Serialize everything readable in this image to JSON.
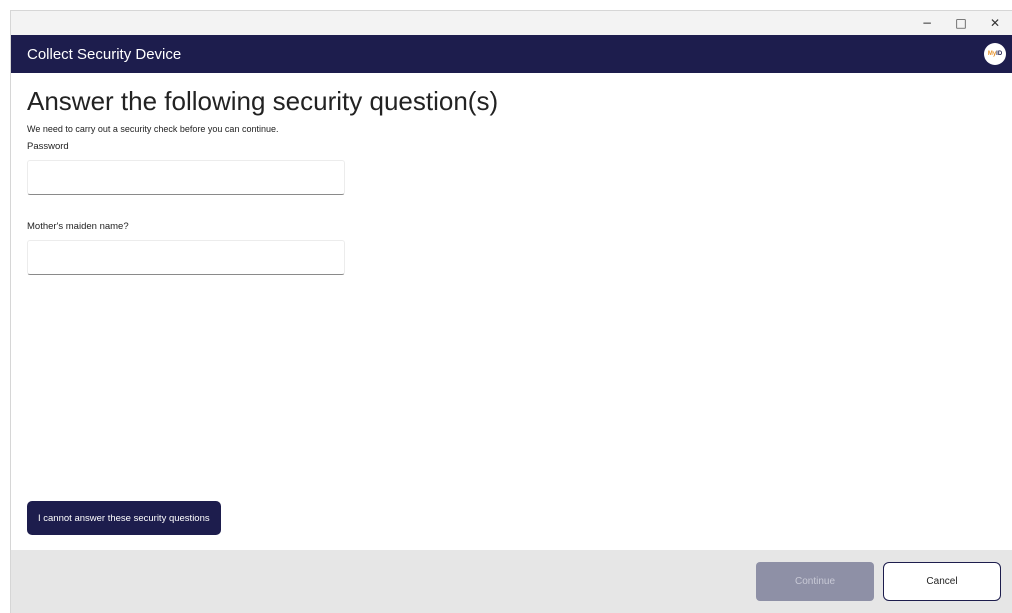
{
  "window": {
    "controls": {
      "minimize": "−",
      "maximize": "□",
      "close": "✕"
    }
  },
  "header": {
    "title": "Collect Security Device",
    "logo_my": "My",
    "logo_id": "ID"
  },
  "main": {
    "title": "Answer the following security question(s)",
    "subtitle": "We need to carry out a security check before you can continue.",
    "fields": [
      {
        "label": "Password",
        "value": "",
        "placeholder": ""
      },
      {
        "label": "Mother's maiden name?",
        "value": "",
        "placeholder": ""
      }
    ],
    "cannot_answer_label": "I cannot answer these security questions"
  },
  "footer": {
    "continue_label": "Continue",
    "cancel_label": "Cancel"
  },
  "colors": {
    "header_bg": "#1d1d4d",
    "continue_disabled_bg": "#8e90a6",
    "footer_bg": "#e6e6e6",
    "logo_accent": "#e8932b"
  }
}
